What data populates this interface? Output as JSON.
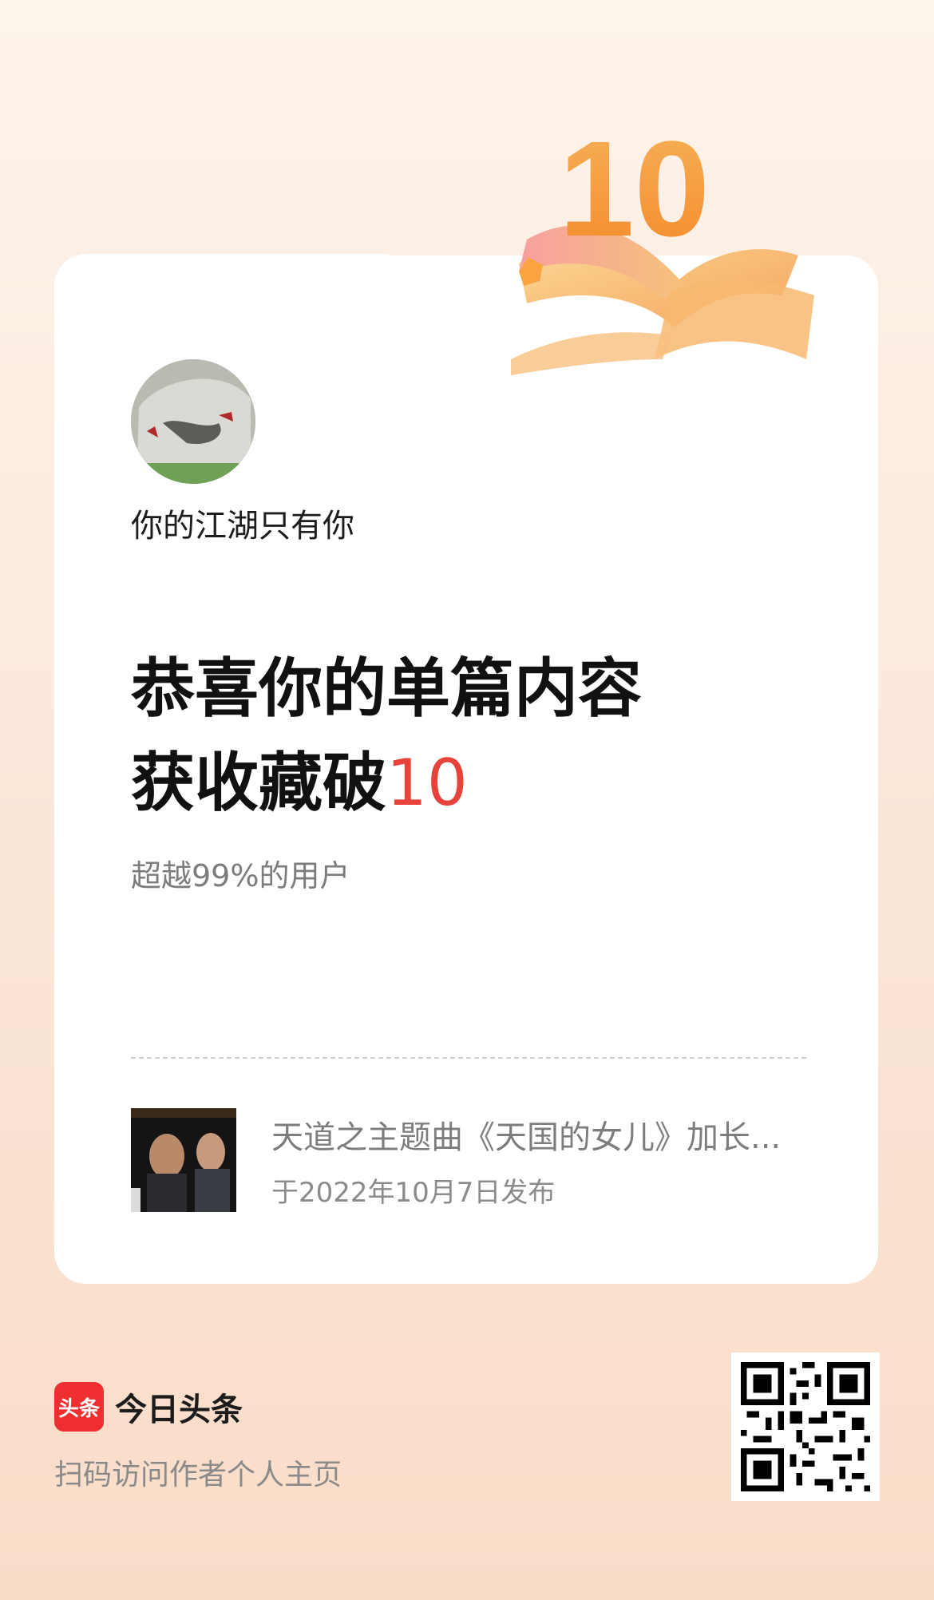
{
  "user": {
    "name": "你的江湖只有你"
  },
  "achievement": {
    "badge_number": "10",
    "line1": "恭喜你的单篇内容",
    "line2_prefix": "获收藏破",
    "line2_number": "10",
    "subtitle": "超越99%的用户"
  },
  "article": {
    "title": "天道之主题曲《天国的女儿》加长...",
    "date": "于2022年10月7日发布"
  },
  "footer": {
    "logo_text": "头条",
    "brand_name": "今日头条",
    "scan_text": "扫码访问作者个人主页"
  },
  "colors": {
    "accent_red": "#e8433a",
    "badge_orange": "#f39a3a",
    "logo_red": "#ef2f2f"
  }
}
